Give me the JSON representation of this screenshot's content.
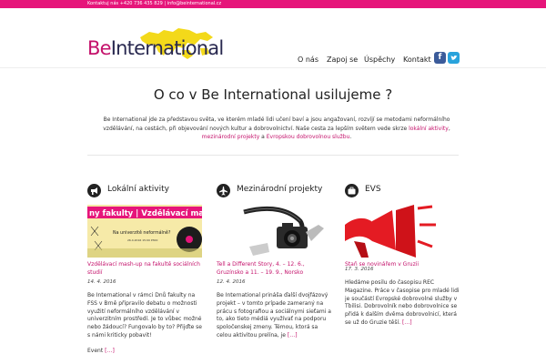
{
  "topbar": {
    "text": "Kontaktuj nás +420 736 435 829  |  info@beinternational.cz"
  },
  "logo": {
    "be": "Be",
    "international": "International"
  },
  "nav": {
    "items": [
      "O nás",
      "Zapoj se",
      "Úspěchy",
      "Kontakt"
    ],
    "facebook": "f",
    "twitter": "t"
  },
  "hero": {
    "title": "O co v Be International usilujeme ?",
    "intro_1": "Be International jde za představou světa, ve kterém mladé lidi učení baví a jsou angažovaní, rozvíjí se metodami neformálního vzdělávání, na cestách, při objevování nových kultur a dobrovolnictví. Naše cesta za lepším světem vede skrze ",
    "link_1": "lokální aktivity",
    "sep_1": ", ",
    "link_2": "mezinárodní projekty",
    "sep_2": " a ",
    "link_3": "Evropskou dobrovolnou službu",
    "end": "."
  },
  "columns": [
    {
      "title": "Lokální aktivity",
      "icon": "megaphone-icon",
      "thumb_banner": "ny fakulty | Vzdělávací mash-u",
      "thumb_question": "Na univerzitě neformálně?",
      "thumb_small": "26.4.2016 15:00 P300",
      "caption": "Vzdělávací mash-up na fakultě sociálních studií",
      "date": "14. 4. 2016",
      "text": "Be International v rámci Dnů fakulty na FSS v Brně připravilo debatu o možnosti využití neformálního vzdělávání v univerzitním prostředí. Je to vůbec možné nebo žádoucí? Fungovalo by to? Přijďte se s námi kriticky pobavit!",
      "more_prefix": "Event ",
      "more_link": "[…]"
    },
    {
      "title": "Mezinárodní projekty",
      "icon": "airplane-icon",
      "caption": "Tell a Different Story, 4. – 12. 6., Gruzínsko a 11. – 19. 9., Norsko",
      "date": "12. 4. 2016",
      "text": "Be International prináša ďalší dvojfázový projekt – v tomto prípade zameraný na prácu s fotografiou a sociálnymi sieťami a to, ako tieto médiá využívať na podporu spoločenskej zmeny. Témou, ktorá sa celou aktivitou prelína, je ",
      "more_link": "[…]"
    },
    {
      "title": "EVS",
      "icon": "suitcase-icon",
      "caption": "Staň se novinářem v Gruzii",
      "date": "17. 3. 2016",
      "text": "Hledáme posilu do časopisu REC Magazine. Práce v časopise pro mladé lidi je součástí Evropské dobrovolné služby v Tbilisi. Dobrovolník nebo dobrovolnice se přidá k dalším dvěma dobrovolnicí, která se už do Gruzie těší. ",
      "more_link": "[…]"
    }
  ],
  "colors": {
    "accent": "#c4126b",
    "topbar": "#e6157a",
    "logo_navy": "#28284f"
  }
}
